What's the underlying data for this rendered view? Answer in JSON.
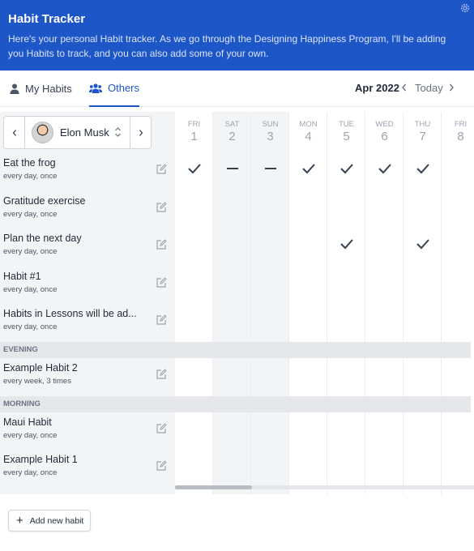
{
  "header": {
    "title": "Habit Tracker",
    "description": "Here's your personal Habit tracker. As we go through the Designing Happiness Program, I'll be adding you Habits to track, and you can also add some of your own."
  },
  "tabs": [
    {
      "label": "My Habits",
      "icon": "user-icon"
    },
    {
      "label": "Others",
      "icon": "users-icon",
      "active": true
    }
  ],
  "calendar": {
    "month": "Apr 2022",
    "today_label": "Today"
  },
  "user": {
    "name": "Elon Musk"
  },
  "days": [
    {
      "dow": "FRI",
      "num": "1",
      "weekend": false
    },
    {
      "dow": "SAT",
      "num": "2",
      "weekend": true
    },
    {
      "dow": "SUN",
      "num": "3",
      "weekend": true
    },
    {
      "dow": "MON",
      "num": "4",
      "weekend": false
    },
    {
      "dow": "TUE",
      "num": "5",
      "weekend": false
    },
    {
      "dow": "WED",
      "num": "6",
      "weekend": false
    },
    {
      "dow": "THU",
      "num": "7",
      "weekend": false
    },
    {
      "dow": "FRI",
      "num": "8",
      "weekend": false
    }
  ],
  "habits": [
    {
      "name": "Eat the frog",
      "freq": "every day, once",
      "marks": [
        "check",
        "dash",
        "dash",
        "check",
        "check",
        "check",
        "check",
        ""
      ]
    },
    {
      "name": "Gratitude exercise",
      "freq": "every day, once",
      "marks": [
        "",
        "",
        "",
        "",
        "",
        "",
        "",
        ""
      ]
    },
    {
      "name": "Plan the next day",
      "freq": "every day, once",
      "marks": [
        "",
        "",
        "",
        "",
        "check",
        "",
        "check",
        ""
      ]
    },
    {
      "name": "Habit #1",
      "freq": "every day, once",
      "marks": [
        "",
        "",
        "",
        "",
        "",
        "",
        "",
        ""
      ]
    },
    {
      "name": "Habits in Lessons will be ad...",
      "freq": "every day, once",
      "marks": [
        "",
        "",
        "",
        "",
        "",
        "",
        "",
        ""
      ]
    },
    {
      "section": "EVENING"
    },
    {
      "name": "Example Habit 2",
      "freq": "every week, 3 times",
      "marks": [
        "",
        "",
        "",
        "",
        "",
        "",
        "",
        ""
      ]
    },
    {
      "section": "MORNING"
    },
    {
      "name": "Maui Habit",
      "freq": "every day, once",
      "marks": [
        "",
        "",
        "",
        "",
        "",
        "",
        "",
        ""
      ]
    },
    {
      "name": "Example Habit 1",
      "freq": "every day, once",
      "marks": [
        "",
        "",
        "",
        "",
        "",
        "",
        "",
        ""
      ]
    }
  ],
  "add_button": {
    "label": "Add new habit"
  },
  "colors": {
    "header_bg": "#1d56c7",
    "accent": "#1d56c7",
    "panel_bg": "#f3f4f6"
  }
}
